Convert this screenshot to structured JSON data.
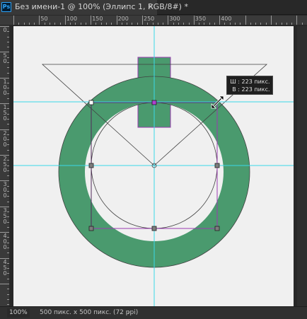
{
  "app": {
    "logo_text": "Ps"
  },
  "document_tab": {
    "title": "Без имени-1 @ 100% (Эллипс 1, RGB/8#) *",
    "close_icon": "close-icon"
  },
  "ruler_top": {
    "labels": [
      "50",
      "100",
      "150",
      "200",
      "250",
      "300",
      "350",
      "400"
    ]
  },
  "ruler_left": {
    "labels": [
      "0",
      "50",
      "100",
      "150",
      "200",
      "250",
      "300",
      "350",
      "400",
      "450"
    ]
  },
  "tooltip": {
    "w_label": "Ш :",
    "w_value": "223 пикс.",
    "h_label": "В :",
    "h_value": "223 пикс."
  },
  "status": {
    "zoom": "100%",
    "doc_info": "500 пикс. x 500 пикс. (72 ppi)",
    "arrow": "›"
  },
  "colors": {
    "shape_fill": "#4a9a6e",
    "guide": "#3ad8e8",
    "path_select": "#b040d0",
    "canvas": "#f0f0f0"
  }
}
